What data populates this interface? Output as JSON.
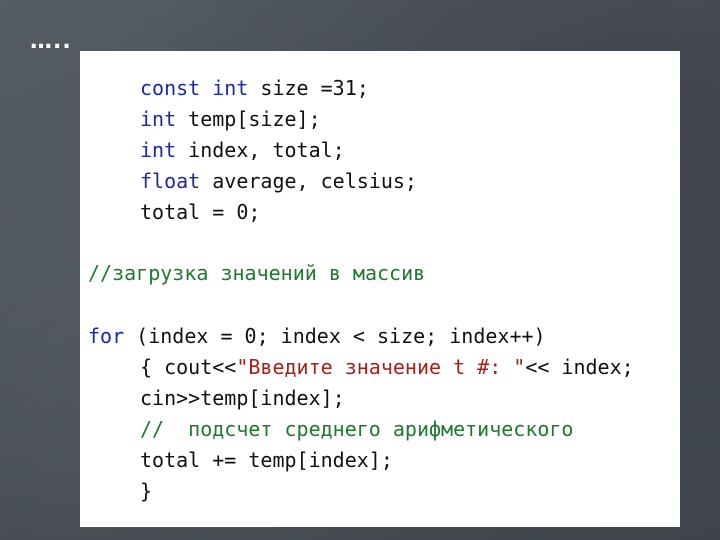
{
  "slide": {
    "title": "….."
  },
  "code": {
    "l1": {
      "kw": "const int",
      "rest": " size =31;"
    },
    "l2": {
      "kw": "int",
      "rest": " temp[size];"
    },
    "l3": {
      "kw": "int",
      "rest": " index, total;"
    },
    "l4": {
      "kw": "float",
      "rest": " average, celsius;"
    },
    "l5": {
      "rest": "total = 0;"
    },
    "l6": {
      "comment": "//загрузка значений в массив"
    },
    "l7": {
      "kw": "for",
      "rest": " (index = 0; index < size; index++)"
    },
    "l8": {
      "pre": "{ cout<<",
      "str": "\"Введите значение t #: \"",
      "post": "<< index;"
    },
    "l9": {
      "rest": "cin>>temp[index];"
    },
    "l10": {
      "comment": "//  подсчет среднего арифметического"
    },
    "l11": {
      "rest": "total += temp[index];"
    },
    "l12": {
      "rest": "}"
    }
  },
  "colors": {
    "keyword": "#1c28a8",
    "string": "#a8201a",
    "comment": "#1f7a2e",
    "background": "#4b5158"
  }
}
